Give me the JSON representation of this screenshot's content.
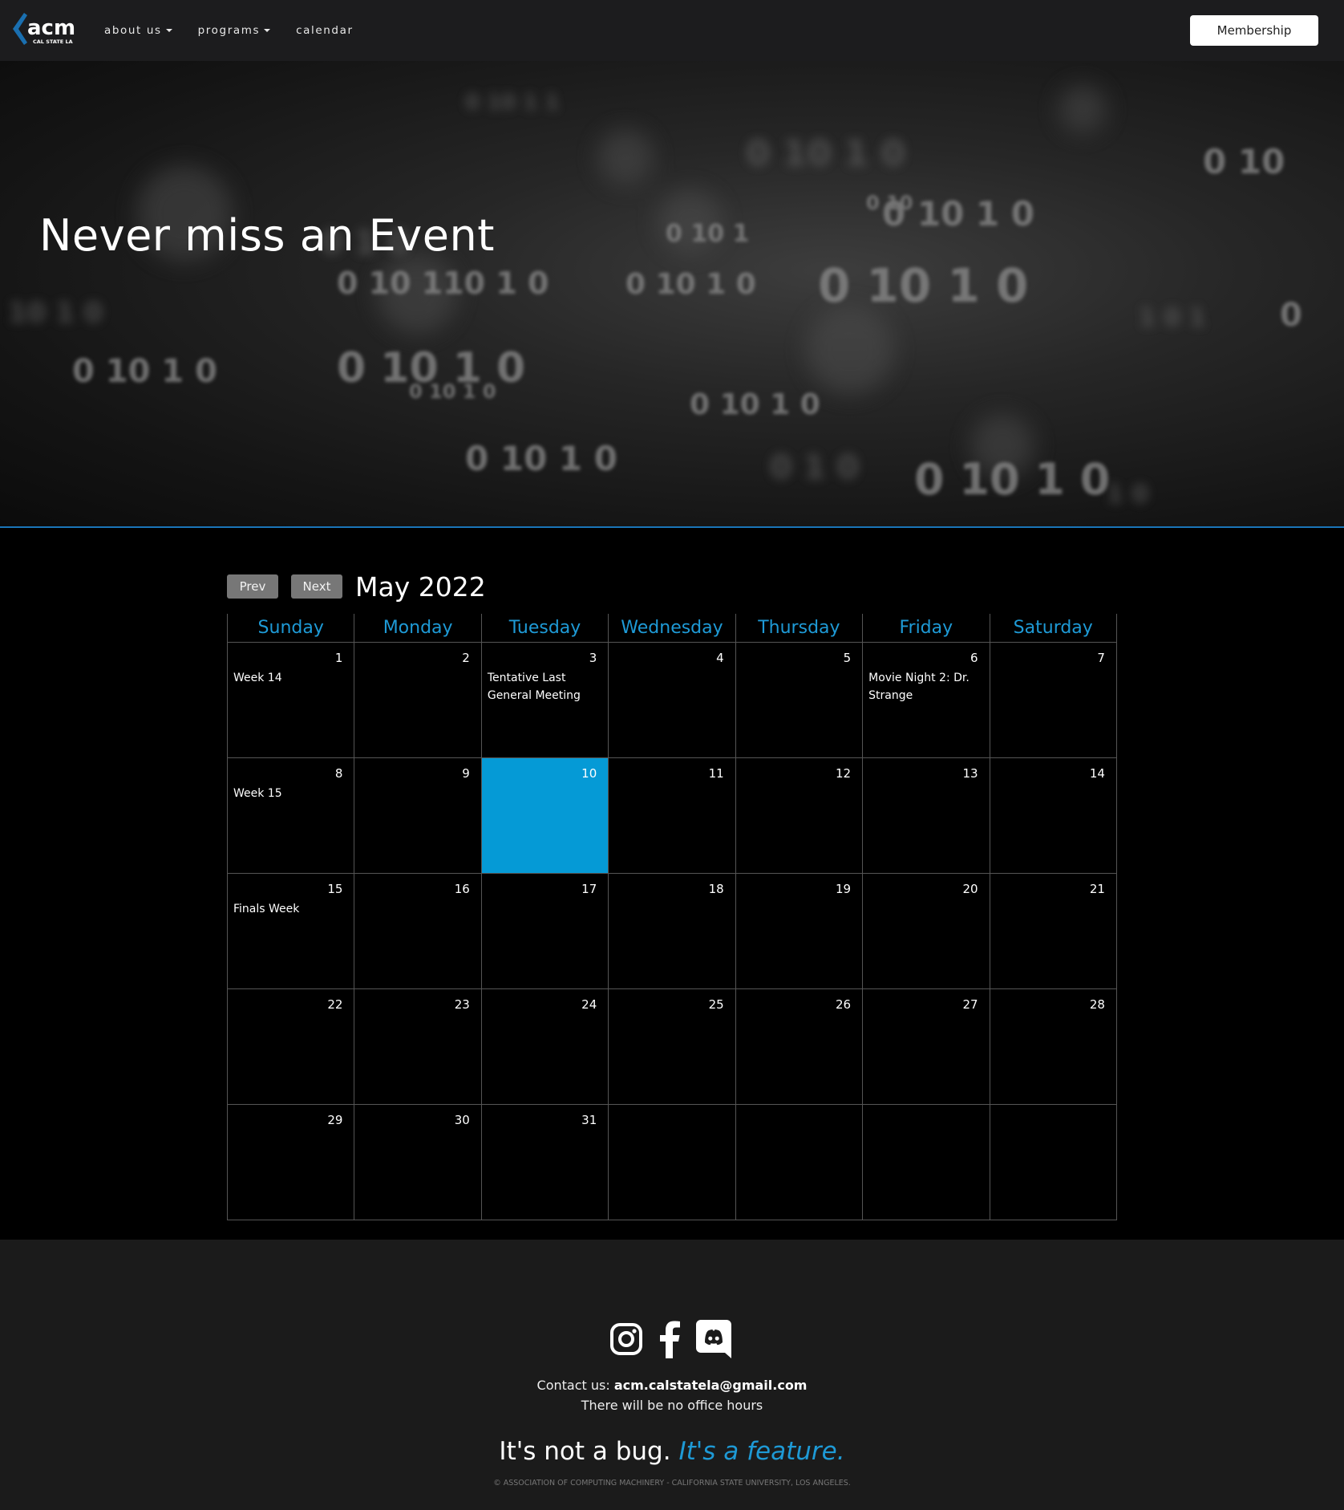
{
  "navbar": {
    "logo_text": "acm",
    "logo_subtext": "CAL STATE LA",
    "links": [
      {
        "label": "about us",
        "dropdown": true
      },
      {
        "label": "programs",
        "dropdown": true
      },
      {
        "label": "calendar",
        "dropdown": false
      }
    ],
    "membership_label": "Membership"
  },
  "hero": {
    "title": "Never miss an Event"
  },
  "calendar": {
    "prev_label": "Prev",
    "next_label": "Next",
    "month_title": "May 2022",
    "day_names": [
      "Sunday",
      "Monday",
      "Tuesday",
      "Wednesday",
      "Thursday",
      "Friday",
      "Saturday"
    ],
    "weeks": [
      [
        {
          "day": "1",
          "event": "Week 14"
        },
        {
          "day": "2",
          "event": ""
        },
        {
          "day": "3",
          "event": "Tentative Last General Meeting"
        },
        {
          "day": "4",
          "event": ""
        },
        {
          "day": "5",
          "event": ""
        },
        {
          "day": "6",
          "event": "Movie Night 2: Dr. Strange"
        },
        {
          "day": "7",
          "event": ""
        }
      ],
      [
        {
          "day": "8",
          "event": "Week 15"
        },
        {
          "day": "9",
          "event": ""
        },
        {
          "day": "10",
          "event": "",
          "today": true
        },
        {
          "day": "11",
          "event": ""
        },
        {
          "day": "12",
          "event": ""
        },
        {
          "day": "13",
          "event": ""
        },
        {
          "day": "14",
          "event": ""
        }
      ],
      [
        {
          "day": "15",
          "event": "Finals Week"
        },
        {
          "day": "16",
          "event": ""
        },
        {
          "day": "17",
          "event": ""
        },
        {
          "day": "18",
          "event": ""
        },
        {
          "day": "19",
          "event": ""
        },
        {
          "day": "20",
          "event": ""
        },
        {
          "day": "21",
          "event": ""
        }
      ],
      [
        {
          "day": "22",
          "event": ""
        },
        {
          "day": "23",
          "event": ""
        },
        {
          "day": "24",
          "event": ""
        },
        {
          "day": "25",
          "event": ""
        },
        {
          "day": "26",
          "event": ""
        },
        {
          "day": "27",
          "event": ""
        },
        {
          "day": "28",
          "event": ""
        }
      ],
      [
        {
          "day": "29",
          "event": ""
        },
        {
          "day": "30",
          "event": ""
        },
        {
          "day": "31",
          "event": ""
        },
        {
          "day": "",
          "event": ""
        },
        {
          "day": "",
          "event": ""
        },
        {
          "day": "",
          "event": ""
        },
        {
          "day": "",
          "event": ""
        }
      ]
    ]
  },
  "footer": {
    "social_icons": [
      "instagram-icon",
      "facebook-icon",
      "discord-icon"
    ],
    "contact_prefix": "Contact us: ",
    "contact_email": "acm.calstatela@gmail.com",
    "office_hours": "There will be no office hours",
    "tagline_plain": "It's not a bug. ",
    "tagline_accent": "It's a feature.",
    "copyright": "© ASSOCIATION OF COMPUTING MACHINERY - CALIFORNIA STATE UNIVERSITY, LOS ANGELES."
  },
  "colors": {
    "accent": "#1e9ad6",
    "today": "#059ad6",
    "navbar_bg": "#1c1c1e",
    "footer_bg": "#1b1b1b"
  }
}
